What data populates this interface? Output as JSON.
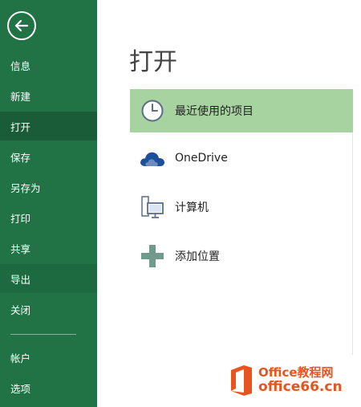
{
  "nav": {
    "items": [
      {
        "label": "信息",
        "state": "normal"
      },
      {
        "label": "新建",
        "state": "normal"
      },
      {
        "label": "打开",
        "state": "active"
      },
      {
        "label": "保存",
        "state": "normal"
      },
      {
        "label": "另存为",
        "state": "normal"
      },
      {
        "label": "打印",
        "state": "normal"
      },
      {
        "label": "共享",
        "state": "normal"
      },
      {
        "label": "导出",
        "state": "hover"
      },
      {
        "label": "关闭",
        "state": "normal"
      },
      {
        "label": "帐户",
        "state": "normal"
      },
      {
        "label": "选项",
        "state": "normal"
      }
    ]
  },
  "main": {
    "title": "打开",
    "places": [
      {
        "label": "最近使用的项目",
        "icon": "clock-icon",
        "selected": true
      },
      {
        "label": "OneDrive",
        "icon": "onedrive-cloud-icon",
        "selected": false
      },
      {
        "label": "计算机",
        "icon": "computer-icon",
        "selected": false
      },
      {
        "label": "添加位置",
        "icon": "plus-icon",
        "selected": false
      }
    ]
  },
  "watermark": {
    "line1": "Office教程网",
    "line2": "office66.cn"
  },
  "colors": {
    "nav_bg": "#217346",
    "nav_active": "#1a5c38",
    "selected_bg": "#a7d3a0",
    "brand_orange": "#e9541e"
  }
}
